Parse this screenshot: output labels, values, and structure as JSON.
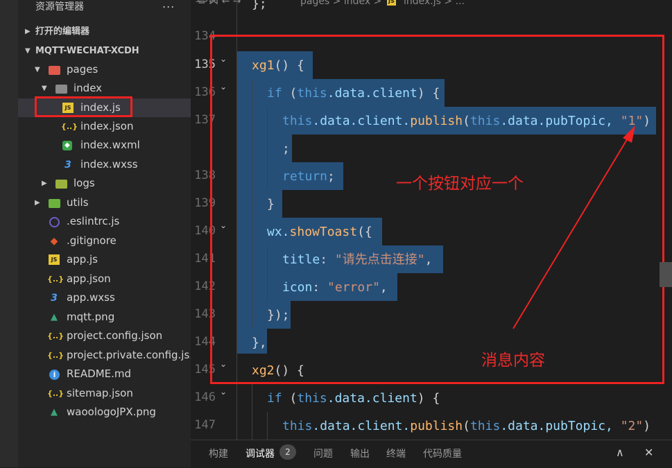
{
  "sidebar": {
    "title": "资源管理器",
    "more": "...",
    "open_editors": "打开的编辑器",
    "project": "MQTT-WECHAT-XCDH",
    "items": [
      {
        "label": "pages"
      },
      {
        "label": "index"
      },
      {
        "label": "index.js"
      },
      {
        "label": "index.json"
      },
      {
        "label": "index.wxml"
      },
      {
        "label": "index.wxss"
      },
      {
        "label": "logs"
      },
      {
        "label": "utils"
      },
      {
        "label": ".eslintrc.js"
      },
      {
        "label": ".gitignore"
      },
      {
        "label": "app.js"
      },
      {
        "label": "app.json"
      },
      {
        "label": "app.wxss"
      },
      {
        "label": "mqtt.png"
      },
      {
        "label": "project.config.json"
      },
      {
        "label": "project.private.config.js..."
      },
      {
        "label": "README.md"
      },
      {
        "label": "sitemap.json"
      },
      {
        "label": "waoologoJPX.png"
      }
    ],
    "icons": {
      "js": "JS",
      "json": "{..}",
      "wxml": "◆",
      "wxss": "3",
      "info": "i",
      "git": "◆",
      "png": "▲"
    }
  },
  "breadcrumb": {
    "nav": "≡  ⋈  ←  →",
    "path": "pages > index > ",
    "js_badge": "JS",
    "file": "index.js > ..."
  },
  "line_numbers": [
    "135",
    "136",
    "137",
    "138",
    "139",
    "140",
    "141",
    "142",
    "143",
    "144",
    "145",
    "146",
    "147"
  ],
  "line_numbers_partial": {
    "top": "133",
    "after_top": "134"
  },
  "code": {
    "prev_close": "};",
    "l135_fn": "xg1",
    "l135_rest": "() {",
    "if_kw": "if",
    "open_paren": " (",
    "this": "this",
    "data_client": ".data.client",
    "close_brace_open": ") {",
    "publish_this": "this",
    "publish_mid": ".data.client.",
    "publish_fn": "publish",
    "publish_open": "(",
    "publish_arg_this": "this",
    "publish_arg": ".data.pubTopic, ",
    "str_1": "\"1\"",
    "str_2": "\"2\"",
    "paren_close": ")",
    "semicolon": ";",
    "return_kw": "return",
    "return_semi": ";",
    "close_brace": "}",
    "wx": "wx.",
    "toast_fn": "showToast",
    "toast_open": "({",
    "title_key": "title",
    "title_colon": ": ",
    "title_val": "\"请先点击连接\"",
    "comma": ",",
    "icon_key": "icon",
    "icon_colon": ": ",
    "icon_val": "\"error\"",
    "toast_close": "});",
    "fn_close": "},",
    "l145_fn": "xg2",
    "l145_rest": "() {"
  },
  "annotations": {
    "button_note": "一个按钮对应一个",
    "message_note": "消息内容"
  },
  "panel": {
    "tabs": [
      "构建",
      "调试器",
      "问题",
      "输出",
      "终端",
      "代码质量"
    ],
    "active_tab": "调试器",
    "badge": "2",
    "collapse": "∧",
    "close": "✕"
  },
  "colors": {
    "annotation_red": "#ee2222",
    "selection": "#264f78",
    "keyword": "#569cd6",
    "function": "#ffb86c",
    "string": "#ce9178"
  }
}
